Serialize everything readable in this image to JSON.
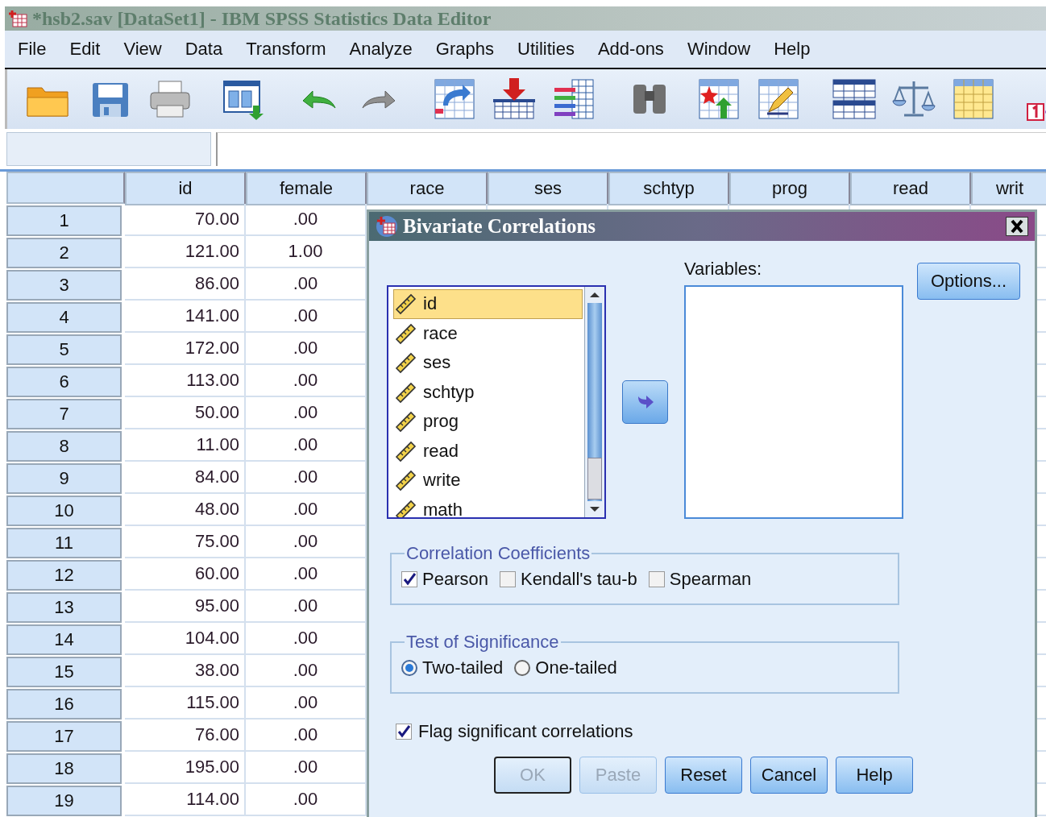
{
  "window": {
    "title": "*hsb2.sav [DataSet1] - IBM SPSS Statistics Data Editor"
  },
  "menu": [
    "File",
    "Edit",
    "View",
    "Data",
    "Transform",
    "Analyze",
    "Graphs",
    "Utilities",
    "Add-ons",
    "Window",
    "Help"
  ],
  "grid": {
    "columns": [
      "id",
      "female",
      "race",
      "ses",
      "schtyp",
      "prog",
      "read",
      "writ"
    ],
    "rows": [
      {
        "number": "1",
        "cells": [
          "70.00",
          ".00"
        ]
      },
      {
        "number": "2",
        "cells": [
          "121.00",
          "1.00"
        ]
      },
      {
        "number": "3",
        "cells": [
          "86.00",
          ".00"
        ]
      },
      {
        "number": "4",
        "cells": [
          "141.00",
          ".00"
        ]
      },
      {
        "number": "5",
        "cells": [
          "172.00",
          ".00"
        ]
      },
      {
        "number": "6",
        "cells": [
          "113.00",
          ".00"
        ]
      },
      {
        "number": "7",
        "cells": [
          "50.00",
          ".00"
        ]
      },
      {
        "number": "8",
        "cells": [
          "11.00",
          ".00"
        ]
      },
      {
        "number": "9",
        "cells": [
          "84.00",
          ".00"
        ]
      },
      {
        "number": "10",
        "cells": [
          "48.00",
          ".00"
        ]
      },
      {
        "number": "11",
        "cells": [
          "75.00",
          ".00"
        ]
      },
      {
        "number": "12",
        "cells": [
          "60.00",
          ".00"
        ]
      },
      {
        "number": "13",
        "cells": [
          "95.00",
          ".00"
        ]
      },
      {
        "number": "14",
        "cells": [
          "104.00",
          ".00"
        ]
      },
      {
        "number": "15",
        "cells": [
          "38.00",
          ".00"
        ]
      },
      {
        "number": "16",
        "cells": [
          "115.00",
          ".00"
        ]
      },
      {
        "number": "17",
        "cells": [
          "76.00",
          ".00"
        ]
      },
      {
        "number": "18",
        "cells": [
          "195.00",
          ".00"
        ]
      },
      {
        "number": "19",
        "cells": [
          "114.00",
          ".00"
        ]
      }
    ]
  },
  "dialog": {
    "title": "Bivariate Correlations",
    "source_list": [
      {
        "label": "id",
        "selected": true
      },
      {
        "label": "race",
        "selected": false
      },
      {
        "label": "ses",
        "selected": false
      },
      {
        "label": "schtyp",
        "selected": false
      },
      {
        "label": "prog",
        "selected": false
      },
      {
        "label": "read",
        "selected": false
      },
      {
        "label": "write",
        "selected": false
      },
      {
        "label": "math",
        "selected": false
      }
    ],
    "variables_label": "Variables:",
    "options_button": "Options...",
    "coefficients": {
      "legend": "Correlation Coefficients",
      "options": [
        {
          "label": "Pearson",
          "checked": true
        },
        {
          "label": "Kendall's tau-b",
          "checked": false
        },
        {
          "label": "Spearman",
          "checked": false
        }
      ]
    },
    "significance": {
      "legend": "Test of Significance",
      "options": [
        {
          "label": "Two-tailed",
          "selected": true
        },
        {
          "label": "One-tailed",
          "selected": false
        }
      ]
    },
    "flag": {
      "label": "Flag significant correlations",
      "checked": true
    },
    "buttons": [
      {
        "label": "OK",
        "disabled": true,
        "default": true
      },
      {
        "label": "Paste",
        "disabled": true,
        "default": false
      },
      {
        "label": "Reset",
        "disabled": false,
        "default": false
      },
      {
        "label": "Cancel",
        "disabled": false,
        "default": false
      },
      {
        "label": "Help",
        "disabled": false,
        "default": false
      }
    ]
  }
}
